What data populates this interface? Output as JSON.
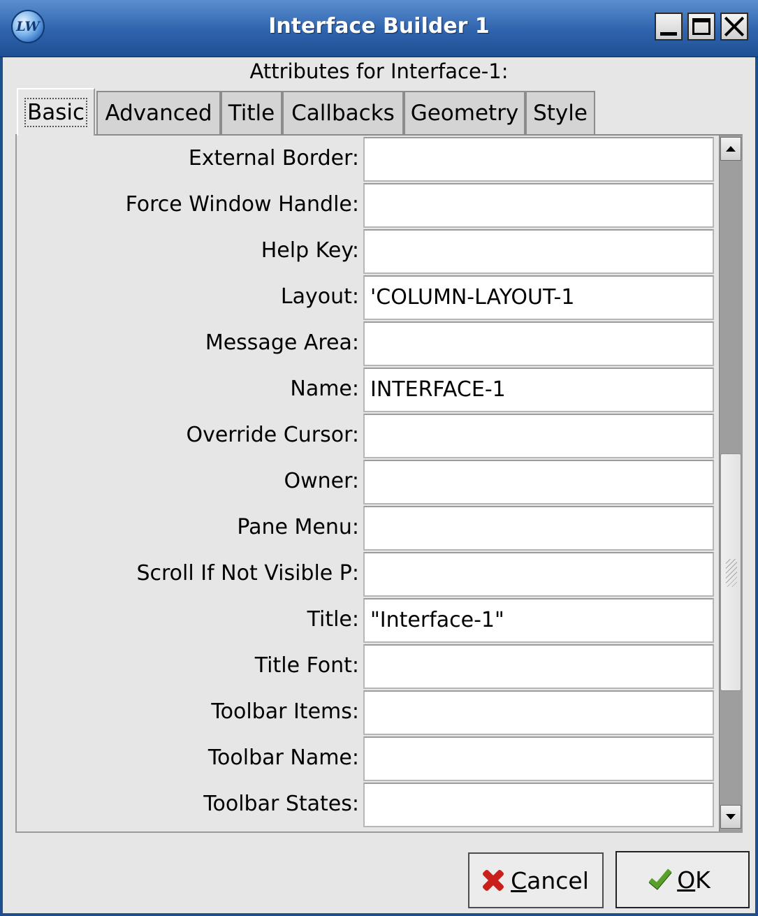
{
  "window": {
    "title": "Interface Builder 1",
    "logo_text": "LW"
  },
  "heading": "Attributes for Interface-1:",
  "tabs": [
    {
      "label": "Basic",
      "active": true
    },
    {
      "label": "Advanced",
      "active": false
    },
    {
      "label": "Title",
      "active": false
    },
    {
      "label": "Callbacks",
      "active": false
    },
    {
      "label": "Geometry",
      "active": false
    },
    {
      "label": "Style",
      "active": false
    }
  ],
  "attributes": [
    {
      "label": "External Border:",
      "value": ""
    },
    {
      "label": "Force Window Handle:",
      "value": ""
    },
    {
      "label": "Help Key:",
      "value": ""
    },
    {
      "label": "Layout:",
      "value": "'COLUMN-LAYOUT-1"
    },
    {
      "label": "Message Area:",
      "value": ""
    },
    {
      "label": "Name:",
      "value": "INTERFACE-1"
    },
    {
      "label": "Override Cursor:",
      "value": ""
    },
    {
      "label": "Owner:",
      "value": ""
    },
    {
      "label": "Pane Menu:",
      "value": ""
    },
    {
      "label": "Scroll If Not Visible P:",
      "value": ""
    },
    {
      "label": "Title:",
      "value": "\"Interface-1\""
    },
    {
      "label": "Title Font:",
      "value": ""
    },
    {
      "label": "Toolbar Items:",
      "value": ""
    },
    {
      "label": "Toolbar Name:",
      "value": ""
    },
    {
      "label": "Toolbar States:",
      "value": ""
    }
  ],
  "buttons": {
    "cancel": {
      "mnemonic": "C",
      "rest": "ancel"
    },
    "ok": {
      "mnemonic": "O",
      "rest": "K"
    }
  },
  "icons": {
    "app": "lispworks-logo-icon",
    "minimize": "minimize-icon",
    "maximize": "maximize-icon",
    "close": "close-icon",
    "cancel": "red-x-icon",
    "ok": "green-checkmark-icon"
  }
}
